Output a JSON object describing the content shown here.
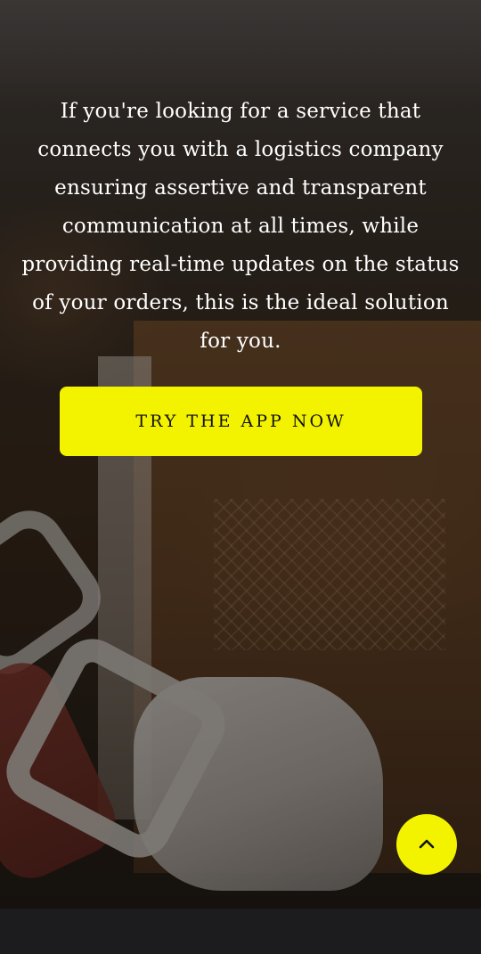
{
  "hero": {
    "message": "If you're looking for a service that connects you with a logistics company ensuring assertive and transparent communication at all times, while providing real-time updates on the status of your orders, this is the ideal solution for you.",
    "cta_label": "TRY THE APP NOW",
    "background_image": "warehouse-worker-taping-cardboard-box"
  },
  "scroll_top": {
    "icon": "chevron-up-icon"
  },
  "colors": {
    "accent": "#f3f300",
    "text": "#ffffff",
    "footer": "#1c1c1f"
  }
}
